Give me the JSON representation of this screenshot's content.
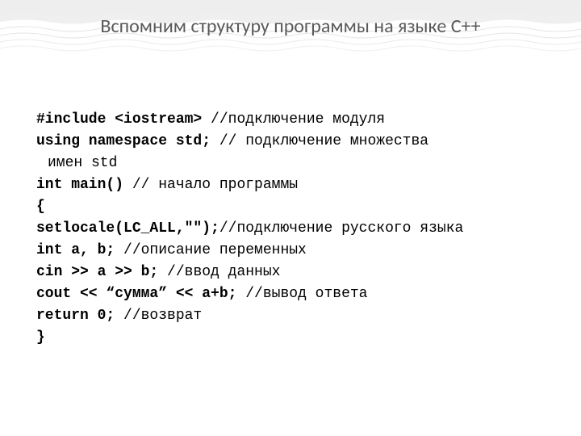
{
  "title": "Вспомним структуру программы на языке С++",
  "code": {
    "l1_kw": "#include <iostream>",
    "l1_cm": " //подключение модуля",
    "l2_kw": "using namespace std;",
    "l2_cm": " // подключение множества",
    "l2_cont": "имен std",
    "l3_kw": "int main()",
    "l3_cm": " // начало программы",
    "l4_kw": "{",
    "l5_kw": "setlocale(LC_ALL,\"\");",
    "l5_cm": "//подключение русского языка",
    "l6_kw": "int a, b;",
    "l6_cm": " //описание переменных",
    "l7_kw": "cin >> a >> b;",
    "l7_cm": " //ввод данных",
    "l8_kw": "cout << “сумма” << a+b;",
    "l8_cm": " //вывод ответа",
    "l9_kw": "return 0;",
    "l9_cm": " //возврат",
    "l10_kw": "}"
  }
}
